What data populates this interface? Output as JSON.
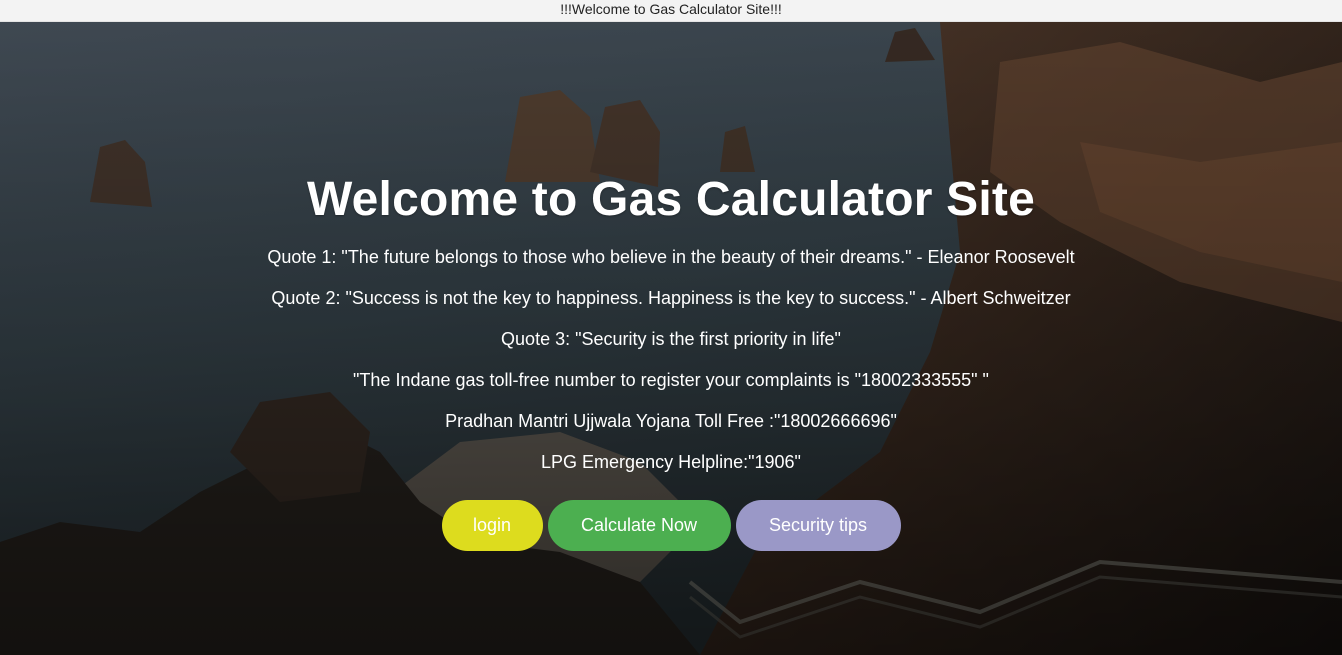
{
  "marquee": {
    "text": "!!!Welcome to Gas Calculator Site!!!"
  },
  "hero": {
    "title": "Welcome to Gas Calculator Site",
    "lines": [
      "Quote 1: \"The future belongs to those who believe in the beauty of their dreams.\" - Eleanor Roosevelt",
      "Quote 2: \"Success is not the key to happiness. Happiness is the key to success.\" - Albert Schweitzer",
      "Quote 3: \"Security is the first priority in life\"",
      "\"The Indane gas toll-free number to register your complaints is \"18002333555\" \"",
      "Pradhan Mantri Ujjwala Yojana Toll Free :\"18002666696\"",
      "LPG Emergency Helpline:\"1906\""
    ]
  },
  "buttons": {
    "login": {
      "label": "login",
      "color": "#dddc1e"
    },
    "calculate": {
      "label": "Calculate Now",
      "color": "#4caf50"
    },
    "security": {
      "label": "Security tips",
      "color": "#9a98c7"
    }
  }
}
